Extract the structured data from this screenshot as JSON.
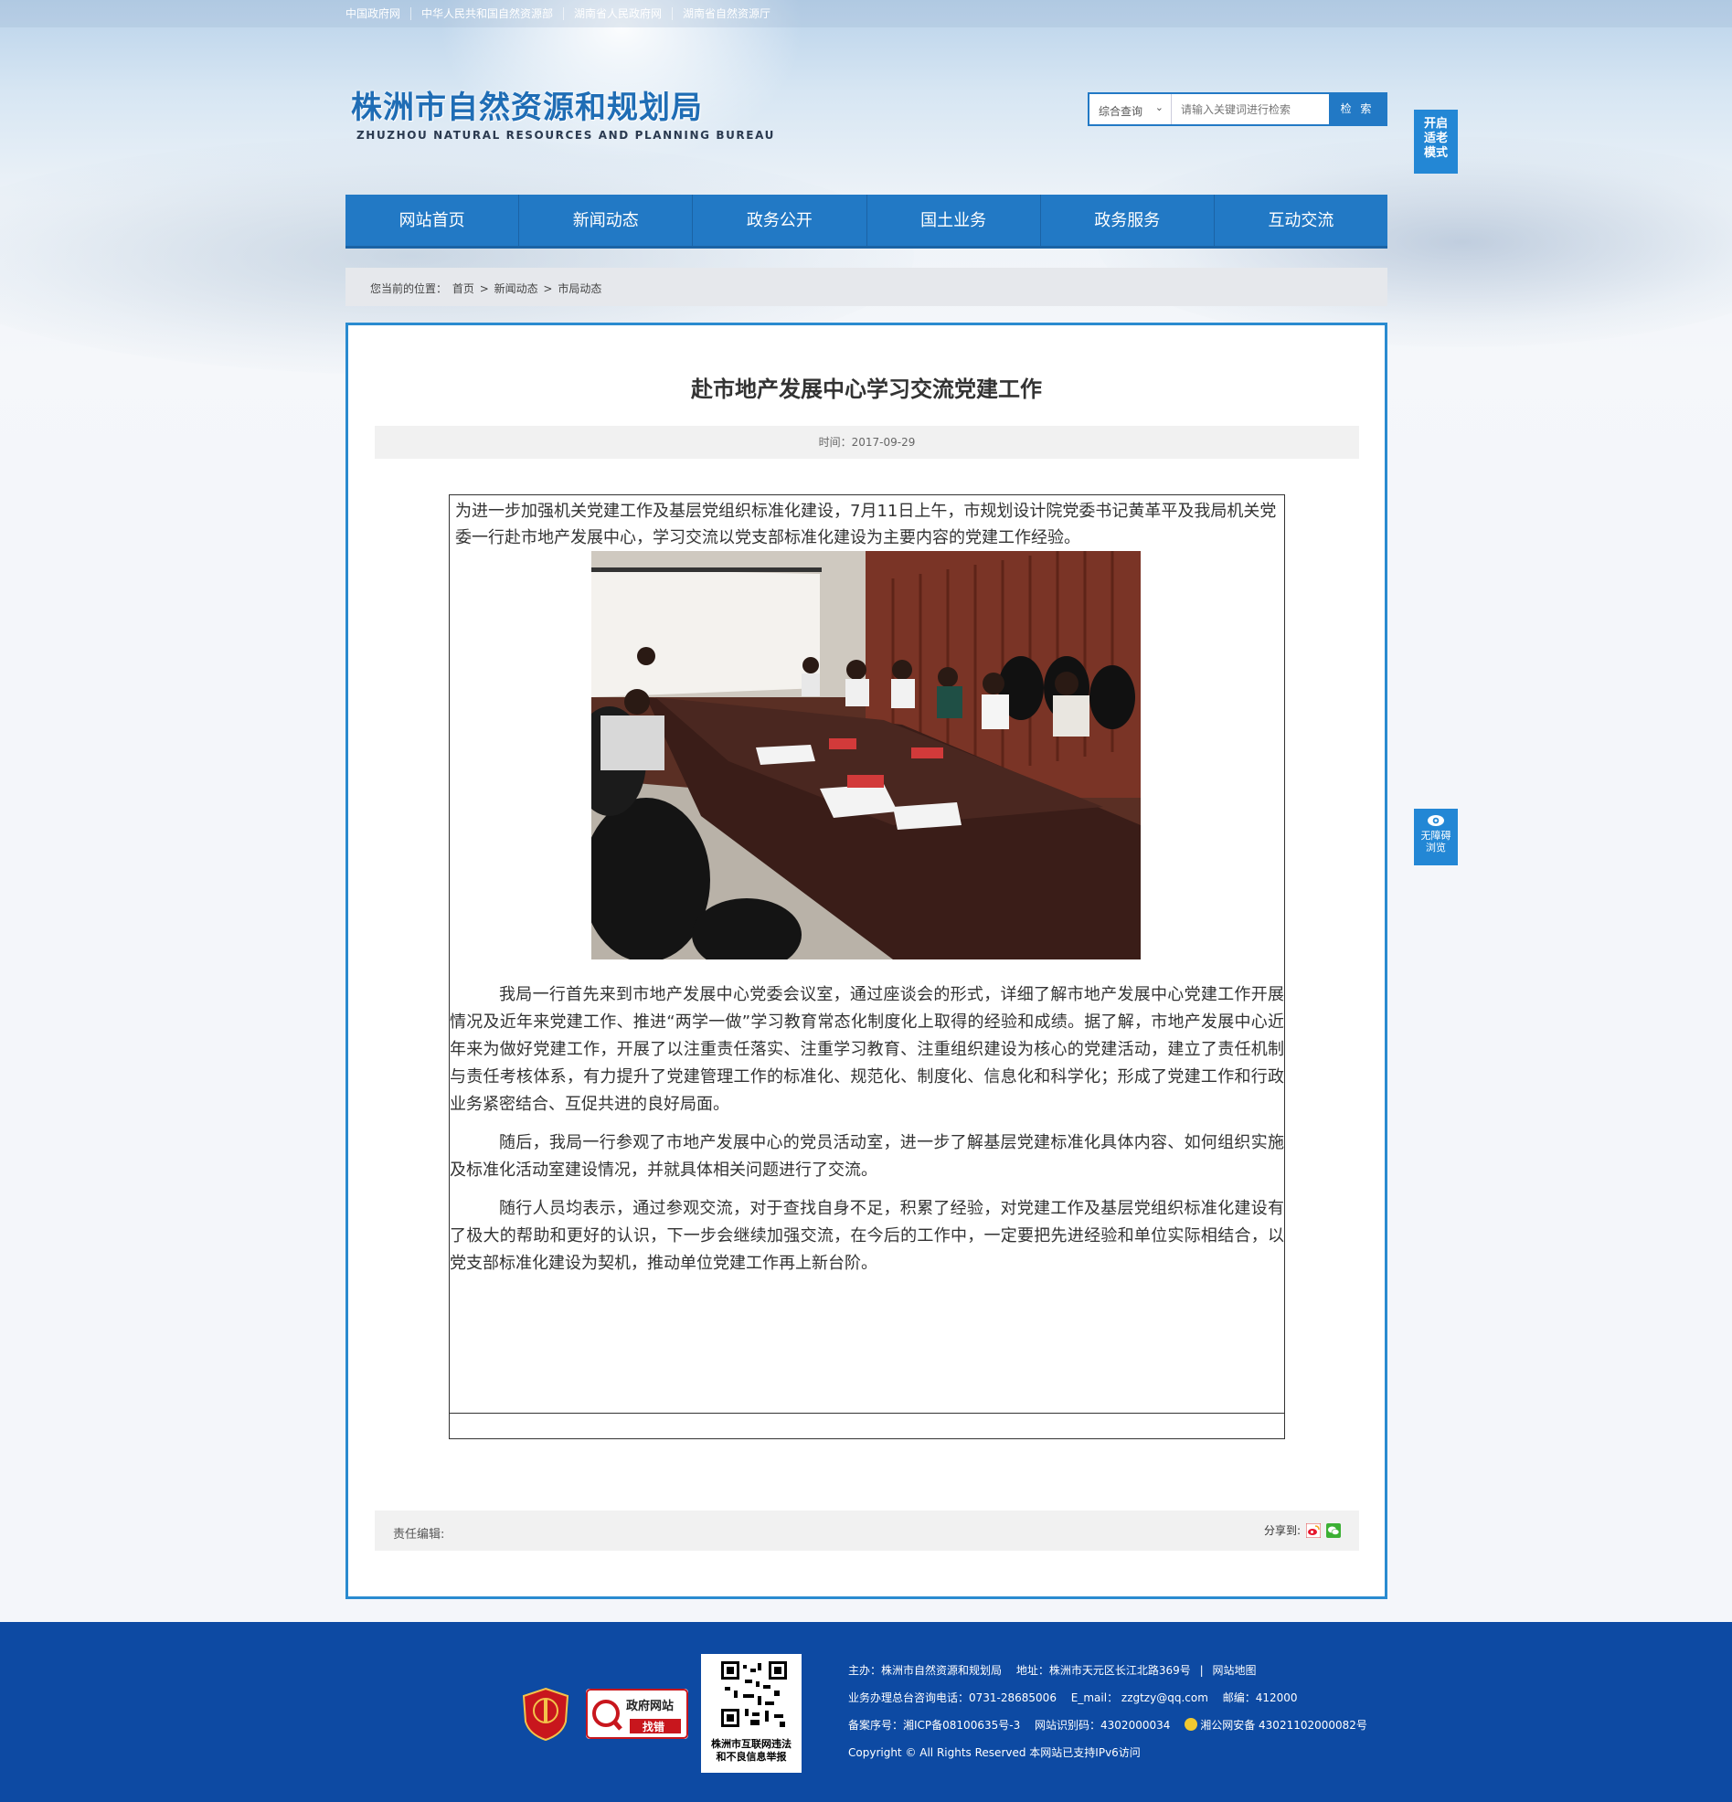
{
  "top_links": [
    "中国政府网",
    "中华人民共和国自然资源部",
    "湖南省人民政府网",
    "湖南省自然资源厅"
  ],
  "logo": {
    "cn": "株洲市自然资源和规划局",
    "en": "ZHUZHOU NATURAL RESOURCES AND PLANNING BUREAU"
  },
  "search": {
    "select_value": "综合查询",
    "placeholder": "请输入关键词进行检索",
    "button": "检 索"
  },
  "side": {
    "elder_mode": [
      "开启",
      "适老",
      "模式"
    ],
    "barrier_free": [
      "无障碍",
      "浏览"
    ]
  },
  "nav": [
    "网站首页",
    "新闻动态",
    "政务公开",
    "国土业务",
    "政务服务",
    "互动交流"
  ],
  "breadcrumb": {
    "label": "您当前的位置：",
    "items": [
      "首页",
      "新闻动态",
      "市局动态"
    ],
    "sep": ">"
  },
  "article": {
    "title": "赴市地产发展中心学习交流党建工作",
    "time_label": "时间：",
    "time": "2017-09-29",
    "intro": "为进一步加强机关党建工作及基层党组织标准化建设，7月11日上午，市规划设计院党委书记黄革平及我局机关党委一行赴市地产发展中心，学习交流以党支部标准化建设为主要内容的党建工作经验。",
    "paragraphs": [
      "我局一行首先来到市地产发展中心党委会议室，通过座谈会的形式，详细了解市地产发展中心党建工作开展情况及近年来党建工作、推进“两学一做”学习教育常态化制度化上取得的经验和成绩。据了解，市地产发展中心近年来为做好党建工作，开展了以注重责任落实、注重学习教育、注重组织建设为核心的党建活动，建立了责任机制与责任考核体系，有力提升了党建管理工作的标准化、规范化、制度化、信息化和科学化；形成了党建工作和行政业务紧密结合、互促共进的良好局面。",
      "随后，我局一行参观了市地产发展中心的党员活动室，进一步了解基层党建标准化具体内容、如何组织实施及标准化活动室建设情况，并就具体相关问题进行了交流。",
      "随行人员均表示，通过参观交流，对于查找自身不足，积累了经验，对党建工作及基层党组织标准化建设有了极大的帮助和更好的认识，下一步会继续加强交流，在今后的工作中，一定要把先进经验和单位实际相结合，以党支部标准化建设为契机，推动单位党建工作再上新台阶。"
    ],
    "editor_label": "责任编辑:",
    "share_label": "分享到:"
  },
  "footer": {
    "badge2_line1": "政府网站",
    "badge2_line2": "找错",
    "badge1_text": "党政机关",
    "qr_caption": [
      "株洲市互联网违法",
      "和不良信息举报"
    ],
    "line1": {
      "sponsor": "主办：株洲市自然资源和规划局",
      "address": "地址：株洲市天元区长江北路369号",
      "sitemap": "网站地图"
    },
    "line2": {
      "phone": "业务办理总台咨询电话：0731-28685006",
      "email": "E_mail： zzgtzy@qq.com",
      "postcode": "邮编：412000"
    },
    "line3": {
      "icp": "备案序号：湘ICP备08100635号-3",
      "site_id": "网站识别码：4302000034",
      "police": "湘公网安备 43021102000082号"
    },
    "line4": "Copyright © All Rights Reserved 本网站已支持IPv6访问"
  },
  "colors": {
    "primary": "#2279c5",
    "panel_border": "#2a8bd0",
    "footer_bg": "#0d4aa3"
  }
}
